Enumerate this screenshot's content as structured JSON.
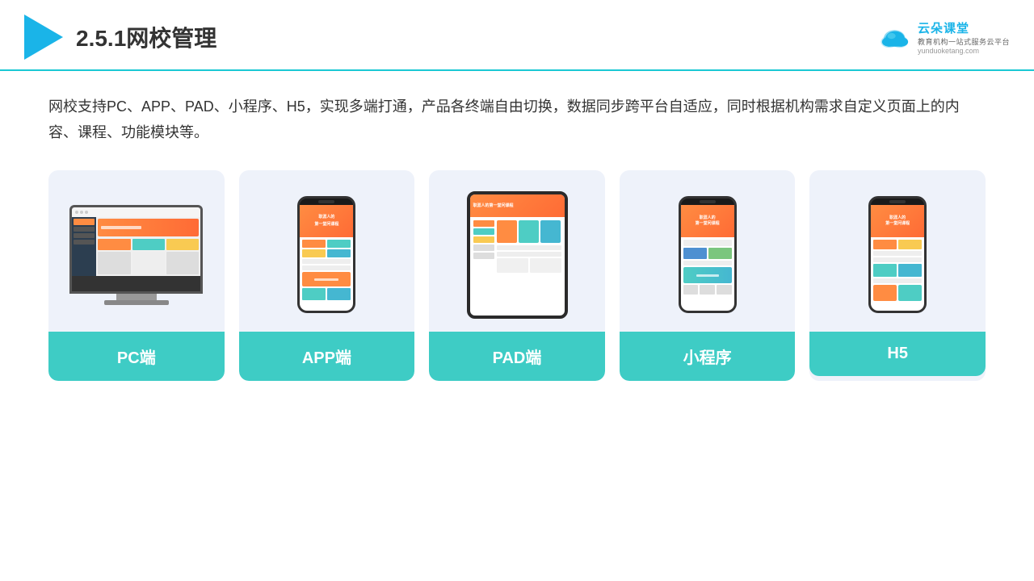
{
  "header": {
    "title": "2.5.1网校管理",
    "brand": {
      "name": "云朵课堂",
      "url": "yunduoketang.com",
      "slogan": "教育机构一站式服务云平台"
    }
  },
  "description": "网校支持PC、APP、PAD、小程序、H5，实现多端打通，产品各终端自由切换，数据同步跨平台自适应，同时根据机构需求自定义页面上的内容、课程、功能模块等。",
  "cards": [
    {
      "id": "pc",
      "label": "PC端",
      "type": "pc"
    },
    {
      "id": "app",
      "label": "APP端",
      "type": "phone"
    },
    {
      "id": "pad",
      "label": "PAD端",
      "type": "tablet"
    },
    {
      "id": "miniapp",
      "label": "小程序",
      "type": "miniapp"
    },
    {
      "id": "h5",
      "label": "H5",
      "type": "h5phone"
    }
  ],
  "colors": {
    "accent": "#1ab4e8",
    "card_bg": "#eef2fa",
    "card_label": "#3eccc5",
    "header_border": "#1ac8d4"
  }
}
